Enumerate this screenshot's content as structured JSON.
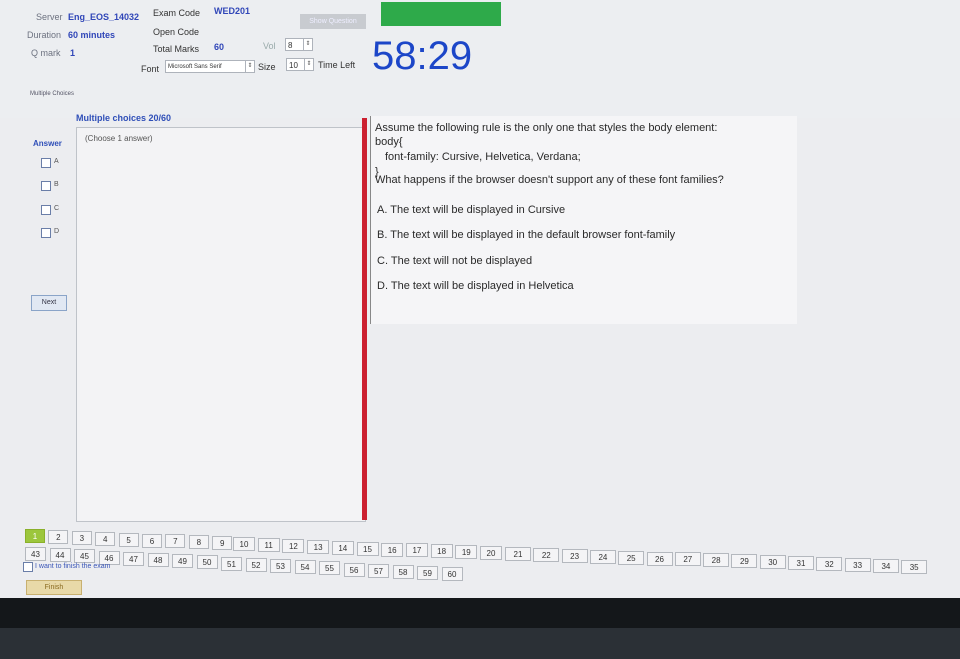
{
  "header": {
    "server_label": "Server",
    "server_value": "Eng_EOS_14032",
    "exam_code_label": "Exam Code",
    "exam_code_value": "WED201",
    "duration_label": "Duration",
    "duration_value": "60 minutes",
    "open_code_label": "Open Code",
    "qmark_label": "Q mark",
    "qmark_value": "1",
    "total_marks_label": "Total Marks",
    "total_marks_value": "60",
    "vol_label": "Vol",
    "vol_value": "8",
    "font_label": "Font",
    "font_value": "Microsoft Sans Serif",
    "size_label": "Size",
    "size_value": "10",
    "time_left_label": "Time Left",
    "time_left_value": "58:29",
    "show_question_button": "Show Question",
    "section_label": "Multiple Choices"
  },
  "question_panel": {
    "heading": "Multiple choices 20/60",
    "answer_label": "Answer",
    "answer_hint": "(Choose 1 answer)",
    "options": [
      "A",
      "B",
      "C",
      "D"
    ],
    "next_button": "Next"
  },
  "question": {
    "lines": [
      "Assume the following rule is the only one that styles the body element:",
      "body{",
      "  font-family: Cursive, Helvetica, Verdana;",
      "}",
      "What happens if the browser doesn't support any of these font families?"
    ],
    "answers": [
      "A. The text will be displayed in Cursive",
      "B. The text will be displayed in the default browser font-family",
      "C. The text will not be displayed",
      "D. The text will be displayed in Helvetica"
    ]
  },
  "navigation": {
    "current": 1,
    "row1": [
      "1",
      "2",
      "3",
      "4",
      "5",
      "6",
      "7",
      "8",
      "9",
      "10",
      "11",
      "12",
      "13",
      "14",
      "15",
      "16",
      "17",
      "18",
      "19",
      "20",
      "21",
      "22",
      "23",
      "24",
      "25",
      "26",
      "27",
      "28",
      "29",
      "30",
      "31",
      "32",
      "33",
      "34",
      "35"
    ],
    "row2": [
      "43",
      "44",
      "45",
      "46",
      "47",
      "48",
      "49",
      "50",
      "51",
      "52",
      "53",
      "54",
      "55",
      "56",
      "57",
      "58",
      "59",
      "60"
    ],
    "finish_checkbox_label": "I want to finish the exam",
    "finish_button": "Finish"
  }
}
